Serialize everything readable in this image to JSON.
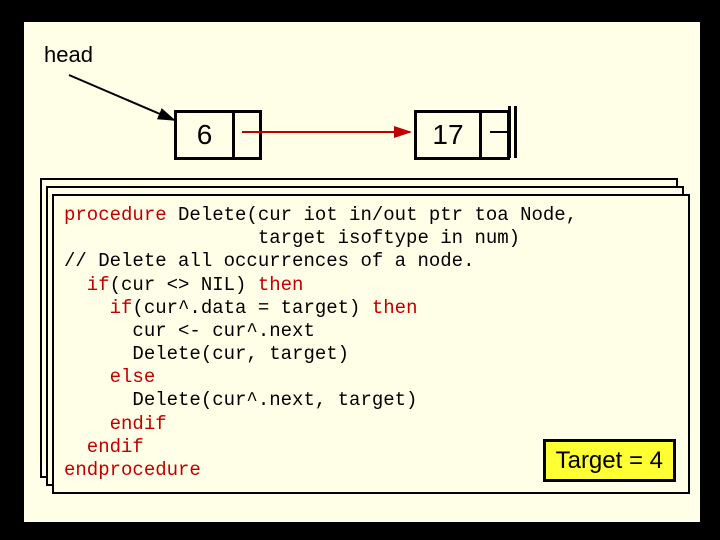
{
  "labels": {
    "head": "head"
  },
  "nodes": {
    "n1": "6",
    "n2": "17"
  },
  "code": {
    "l1a": "procedure",
    "l1b": " Delete(cur iot in/out ptr toa Node,",
    "l2": "                 target isoftype in num)",
    "l3": "// Delete all occurrences of a node.",
    "l4a": "  if",
    "l4b": "(cur <> NIL) ",
    "l4c": "then",
    "l5a": "    if",
    "l5b": "(cur^.data = target) ",
    "l5c": "then",
    "l6": "      cur <- cur^.next",
    "l7": "      Delete(cur, target)",
    "l8": "    else",
    "l9": "      Delete(cur^.next, target)",
    "l10": "    endif",
    "l11": "  endif",
    "l12": "endprocedure"
  },
  "target": {
    "label": "Target = 4"
  }
}
